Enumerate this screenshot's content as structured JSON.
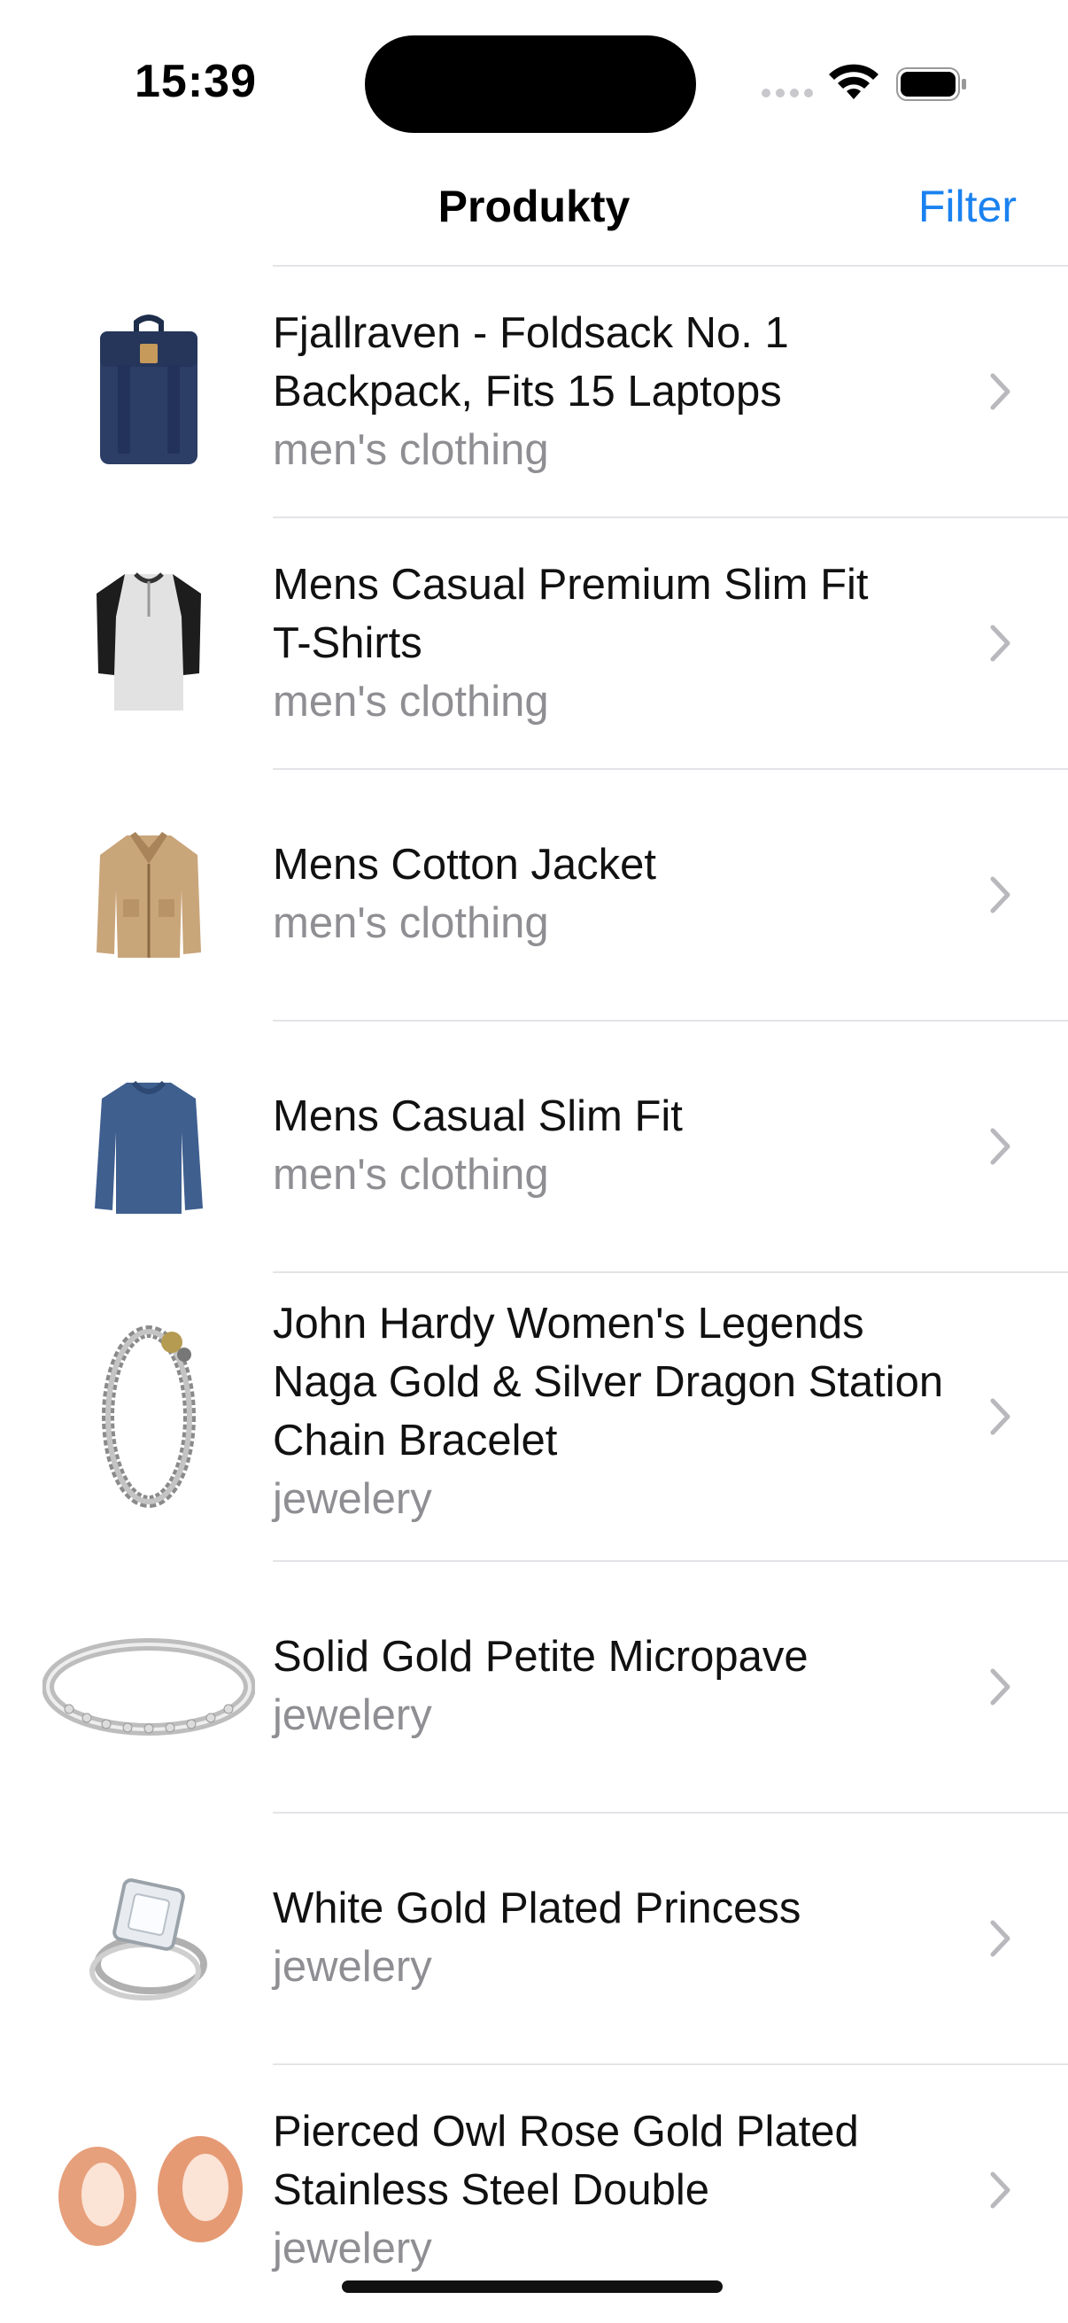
{
  "status": {
    "time": "15:39"
  },
  "nav": {
    "title": "Produkty",
    "filter_label": "Filter"
  },
  "colors": {
    "accent": "#1a82f0",
    "secondary_text": "#8e8e93",
    "separator": "#e4e4e8"
  },
  "products": [
    {
      "title_lines": [
        "Fjallraven - Foldsack No. 1",
        "Backpack, Fits 15 Laptops"
      ],
      "category": "men's clothing",
      "icon": "backpack-icon"
    },
    {
      "title_lines": [
        "Mens Casual Premium Slim Fit",
        "T-Shirts"
      ],
      "category": "men's clothing",
      "icon": "tshirt-icon"
    },
    {
      "title_lines": [
        "Mens Cotton Jacket"
      ],
      "category": "men's clothing",
      "icon": "jacket-icon"
    },
    {
      "title_lines": [
        "Mens Casual Slim Fit"
      ],
      "category": "men's clothing",
      "icon": "longsleeve-icon"
    },
    {
      "title_lines": [
        "John Hardy Women's Legends",
        "Naga Gold & Silver Dragon Station",
        "Chain Bracelet"
      ],
      "category": "jewelery",
      "icon": "bracelet-icon"
    },
    {
      "title_lines": [
        "Solid Gold Petite Micropave"
      ],
      "category": "jewelery",
      "icon": "ring-band-icon"
    },
    {
      "title_lines": [
        "White Gold Plated Princess"
      ],
      "category": "jewelery",
      "icon": "diamond-ring-icon"
    },
    {
      "title_lines": [
        "Pierced Owl Rose Gold Plated",
        "Stainless Steel Double"
      ],
      "category": "jewelery",
      "icon": "ear-tunnels-icon"
    }
  ]
}
